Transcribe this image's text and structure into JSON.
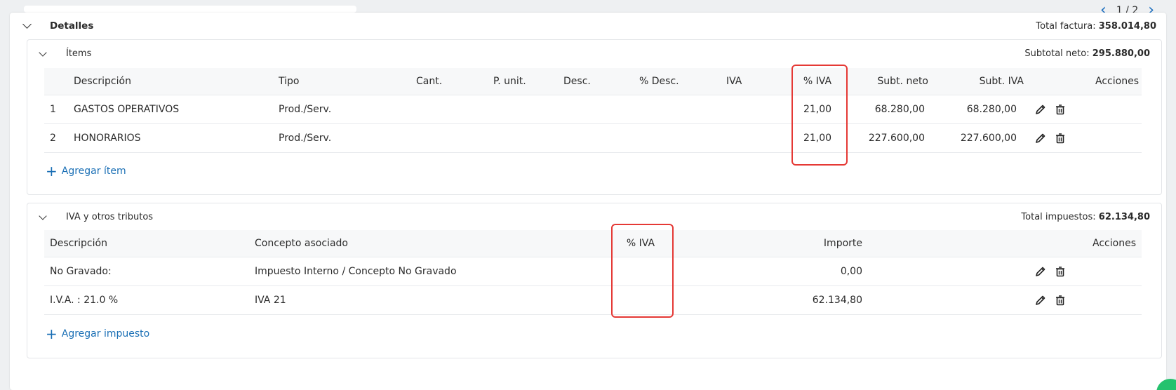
{
  "pager": {
    "text": "1 / 2"
  },
  "detalles": {
    "title": "Detalles",
    "total_label": "Total factura:",
    "total_value": "358.014,80"
  },
  "items": {
    "title": "Ítems",
    "subtotal_label": "Subtotal neto:",
    "subtotal_value": "295.880,00",
    "columns": [
      "Descripción",
      "Tipo",
      "Cant.",
      "P. unit.",
      "Desc.",
      "% Desc.",
      "IVA",
      "% IVA",
      "Subt. neto",
      "Subt. IVA",
      "Acciones"
    ],
    "rows": [
      {
        "n": "1",
        "descripcion": "GASTOS OPERATIVOS",
        "tipo": "Prod./Serv.",
        "pct_iva": "21,00",
        "subt_neto": "68.280,00",
        "subt_iva": "68.280,00"
      },
      {
        "n": "2",
        "descripcion": "HONORARIOS",
        "tipo": "Prod./Serv.",
        "pct_iva": "21,00",
        "subt_neto": "227.600,00",
        "subt_iva": "227.600,00"
      }
    ],
    "add_label": "Agregar ítem"
  },
  "tributos": {
    "title": "IVA y otros tributos",
    "total_label": "Total impuestos:",
    "total_value": "62.134,80",
    "columns": [
      "Descripción",
      "Concepto asociado",
      "% IVA",
      "Importe",
      "Acciones"
    ],
    "rows": [
      {
        "descripcion": "No Gravado:",
        "concepto": "Impuesto Interno / Concepto No Gravado",
        "pct_iva": "",
        "importe": "0,00"
      },
      {
        "descripcion": "I.V.A. : 21.0 %",
        "concepto": "IVA 21",
        "pct_iva": "",
        "importe": "62.134,80"
      }
    ],
    "add_label": "Agregar impuesto"
  },
  "colors": {
    "accent": "#1a6fb5",
    "highlight": "#e53935"
  },
  "icons": [
    "chevron-down-icon",
    "pencil-icon",
    "trash-icon",
    "plus-icon",
    "chevron-left-icon",
    "chevron-right-icon"
  ]
}
